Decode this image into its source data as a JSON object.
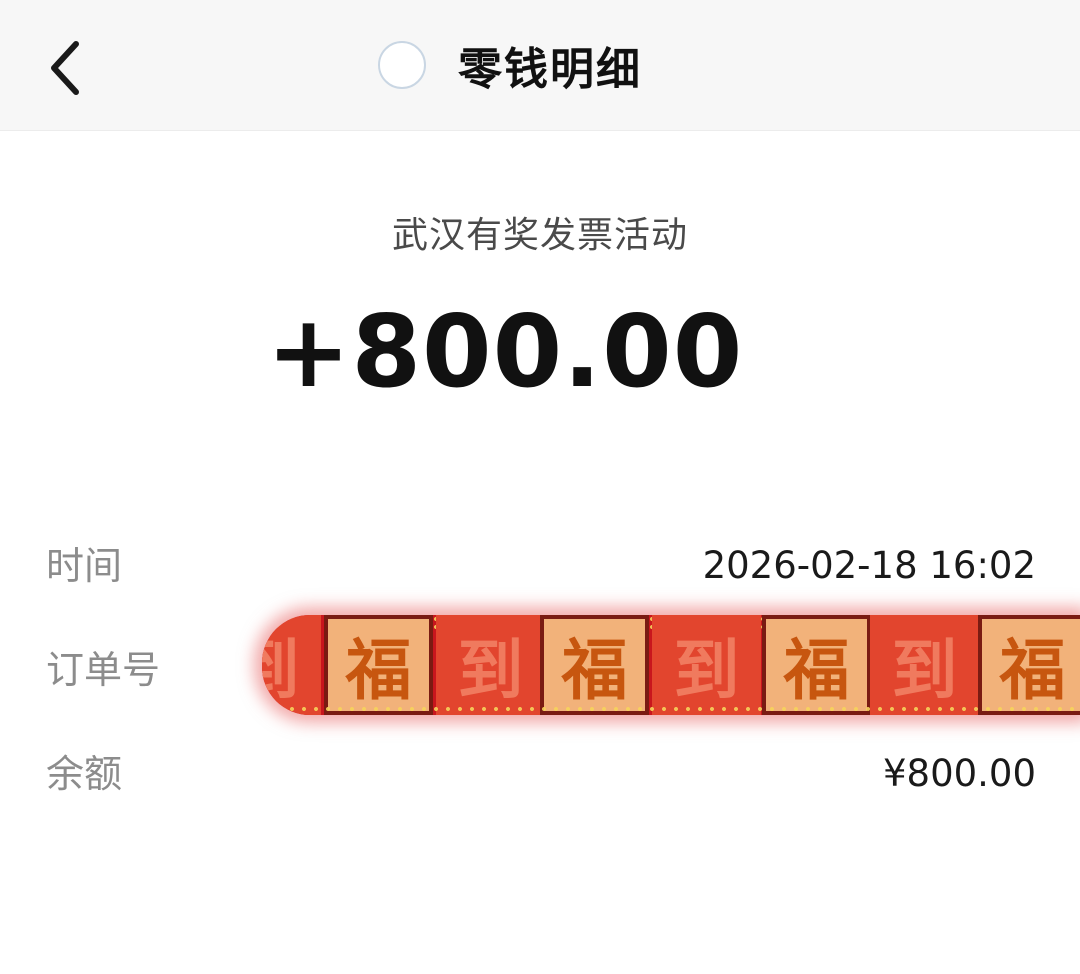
{
  "nav": {
    "title": "零钱明细",
    "back_icon": "chevron-left-icon"
  },
  "transaction": {
    "event_name": "武汉有奖发票活动",
    "amount": "+800.00"
  },
  "details": {
    "time_label": "时间",
    "time_value": "2026-02-18 16:02",
    "order_label": "订单号",
    "sticker_chars": [
      "到",
      "福",
      "到",
      "福",
      "到",
      "福",
      "到",
      "福"
    ],
    "balance_label": "余额",
    "balance_value": "¥800.00"
  },
  "colors": {
    "background": "#ffffff",
    "nav_background": "#f7f7f7",
    "label_gray": "#8c8c8c",
    "sticker_red": "#c8161d",
    "sticker_gold": "#f2b27a"
  }
}
